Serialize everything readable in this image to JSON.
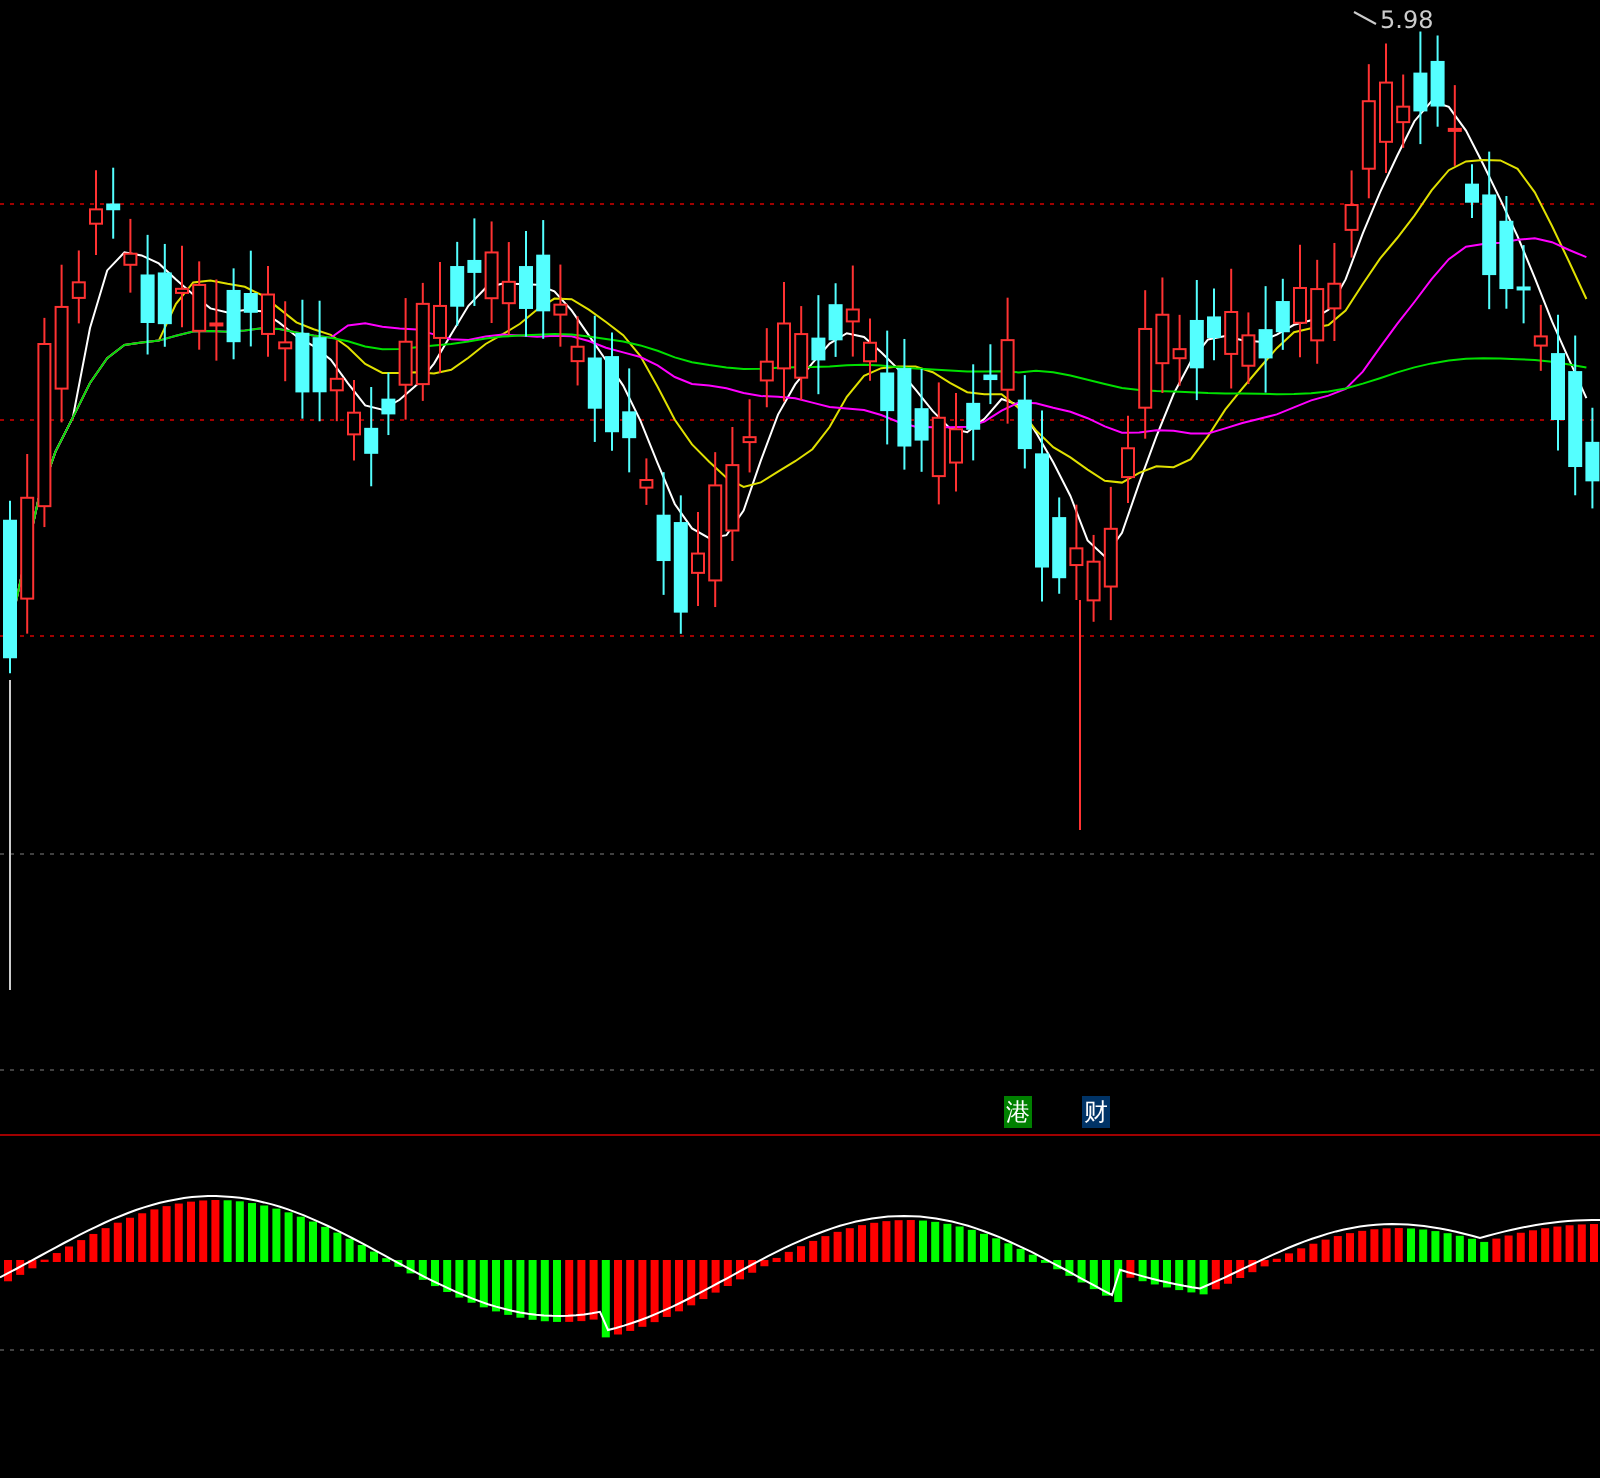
{
  "price_chart": {
    "high_label": "5.98"
  },
  "indicator_panel": {
    "badges": [
      {
        "text": "港",
        "color": "#008000"
      },
      {
        "text": "财",
        "color": "#003366"
      }
    ]
  }
}
